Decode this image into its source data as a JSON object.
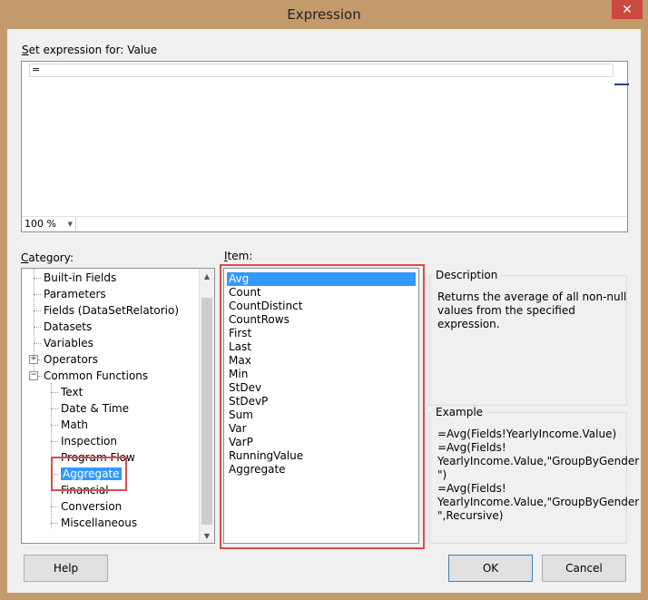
{
  "window": {
    "title": "Expression",
    "close_glyph": "✕"
  },
  "expression": {
    "label_prefix": "",
    "label_mnemonic": "S",
    "label_rest": "et expression for: Value",
    "text": "=",
    "zoom": "100 %"
  },
  "category": {
    "label_mnemonic": "C",
    "label_rest": "ategory:",
    "nodes": [
      "Built-in Fields",
      "Parameters",
      "Fields (DataSetRelatorio)",
      "Datasets",
      "Variables",
      "Operators",
      "Common Functions",
      "Text",
      "Date & Time",
      "Math",
      "Inspection",
      "Program Flow",
      "Aggregate",
      "Financial",
      "Conversion",
      "Miscellaneous"
    ],
    "expander_operators": "+",
    "expander_common": "−"
  },
  "item": {
    "label_mnemonic": "I",
    "label_rest": "tem:",
    "values": [
      "Avg",
      "Count",
      "CountDistinct",
      "CountRows",
      "First",
      "Last",
      "Max",
      "Min",
      "StDev",
      "StDevP",
      "Sum",
      "Var",
      "VarP",
      "RunningValue",
      "Aggregate"
    ],
    "selected_index": 0
  },
  "description": {
    "title": "Description",
    "line1": "Returns the average of all non-null",
    "line2": "values from the specified expression."
  },
  "example": {
    "title": "Example",
    "lines": [
      "=Avg(Fields!YearlyIncome.Value)",
      "=Avg(Fields!",
      "YearlyIncome.Value,\"GroupByGender",
      "\")",
      "=Avg(Fields!",
      "YearlyIncome.Value,\"GroupByGender",
      "\",Recursive)"
    ]
  },
  "buttons": {
    "help": "Help",
    "ok": "OK",
    "cancel": "Cancel"
  },
  "colors": {
    "selection": "#3399ff",
    "highlight": "#e04a4a",
    "frame": "#c39a6b"
  }
}
